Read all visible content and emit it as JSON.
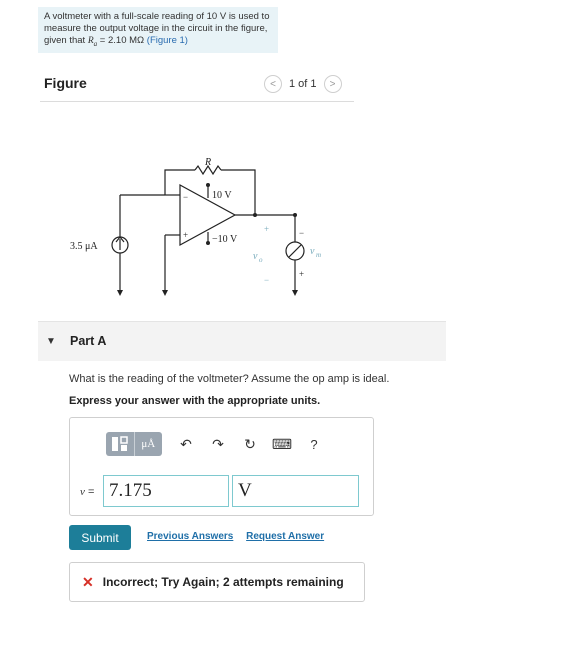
{
  "problem": {
    "line1": "A voltmeter with a full-scale reading of 10 V is used to",
    "line2": "measure the output voltage in the circuit in the figure,",
    "line3_pre": "given that",
    "line3_math": "R",
    "line3_sub": "a",
    "line3_val": " = 2.10 MΩ",
    "figure_link": "(Figure 1)"
  },
  "figure": {
    "title": "Figure",
    "pager_text": "1 of 1",
    "prev_glyph": "<",
    "next_glyph": ">"
  },
  "circuit": {
    "current_source_label": "3.5 μA",
    "resistor_label": "R",
    "pos_supply": "10 V",
    "neg_supply": "−10 V",
    "plus_sign": "+",
    "minus_sign": "−",
    "output_label": "v",
    "output_sub": "o",
    "meter_label": "v",
    "meter_sub": "m",
    "meter_plus": "+",
    "meter_minus": "−"
  },
  "part": {
    "label": "Part A",
    "question": "What is the reading of the voltmeter? Assume the op amp is ideal.",
    "instructions": "Express your answer with the appropriate units."
  },
  "toolbar": {
    "units_glyph": "μÅ",
    "undo_glyph": "↶",
    "redo_glyph": "↷",
    "reset_glyph": "↻",
    "keyboard_glyph": "⌨",
    "help_glyph": "?"
  },
  "answer": {
    "variable_label": "v",
    "equals": " =",
    "value": "7.175",
    "unit": "V"
  },
  "actions": {
    "submit": "Submit",
    "previous_answers": "Previous Answers",
    "request_answer": "Request Answer"
  },
  "feedback": {
    "icon": "✕",
    "message": "Incorrect; Try Again; 2 attempts remaining"
  }
}
